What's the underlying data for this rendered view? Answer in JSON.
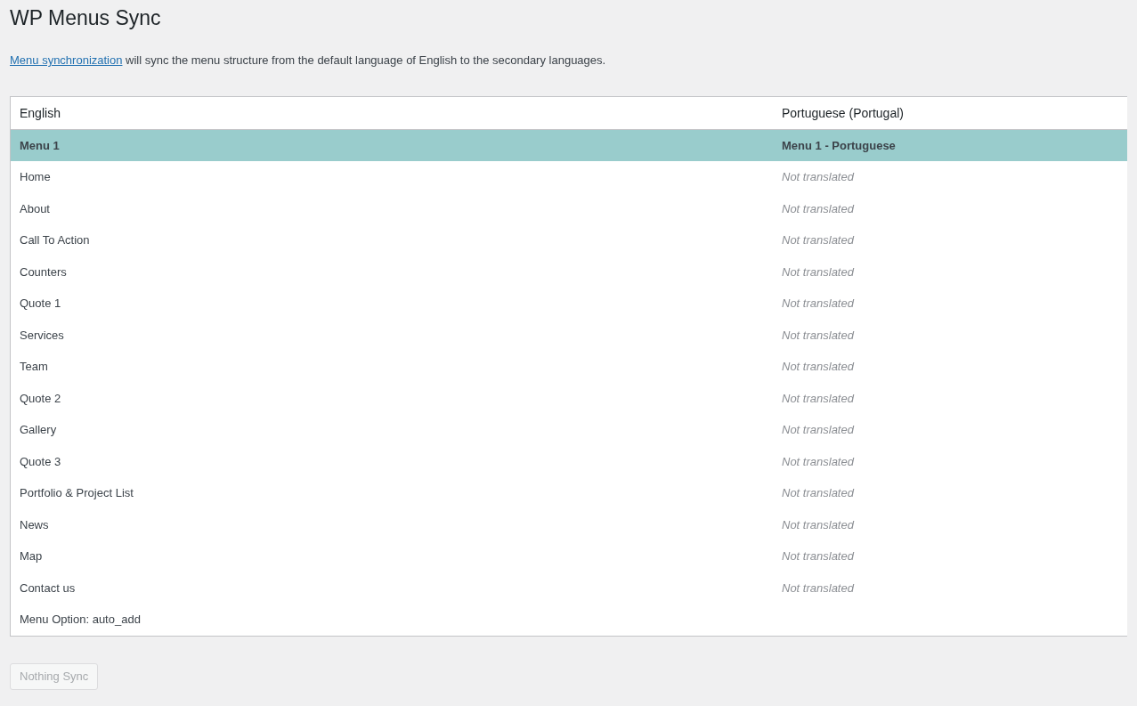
{
  "page": {
    "title": "WP Menus Sync"
  },
  "intro": {
    "link": "Menu synchronization",
    "text": " will sync the menu structure from the default language of English to the secondary languages."
  },
  "table": {
    "columns": [
      "English",
      "Portuguese (Portugal)"
    ],
    "rows": [
      {
        "kind": "menu",
        "english": "Menu 1",
        "translation": "Menu 1 - Portuguese",
        "selected": true
      },
      {
        "kind": "item",
        "english": "Home",
        "translation": "Not translated",
        "translated": false
      },
      {
        "kind": "item",
        "english": "About",
        "translation": "Not translated",
        "translated": false
      },
      {
        "kind": "item",
        "english": "Call To Action",
        "translation": "Not translated",
        "translated": false
      },
      {
        "kind": "item",
        "english": "Counters",
        "translation": "Not translated",
        "translated": false
      },
      {
        "kind": "item",
        "english": "Quote 1",
        "translation": "Not translated",
        "translated": false
      },
      {
        "kind": "item",
        "english": "Services",
        "translation": "Not translated",
        "translated": false
      },
      {
        "kind": "item",
        "english": "Team",
        "translation": "Not translated",
        "translated": false
      },
      {
        "kind": "item",
        "english": "Quote 2",
        "translation": "Not translated",
        "translated": false
      },
      {
        "kind": "item",
        "english": "Gallery",
        "translation": "Not translated",
        "translated": false
      },
      {
        "kind": "item",
        "english": "Quote 3",
        "translation": "Not translated",
        "translated": false
      },
      {
        "kind": "item",
        "english": "Portfolio & Project List",
        "translation": "Not translated",
        "translated": false
      },
      {
        "kind": "item",
        "english": "News",
        "translation": "Not translated",
        "translated": false
      },
      {
        "kind": "item",
        "english": "Map",
        "translation": "Not translated",
        "translated": false
      },
      {
        "kind": "item",
        "english": "Contact us",
        "translation": "Not translated",
        "translated": false
      },
      {
        "kind": "option",
        "english": "Menu Option: auto_add"
      }
    ]
  },
  "sync_button": {
    "label": "Nothing Sync",
    "disabled": true
  }
}
